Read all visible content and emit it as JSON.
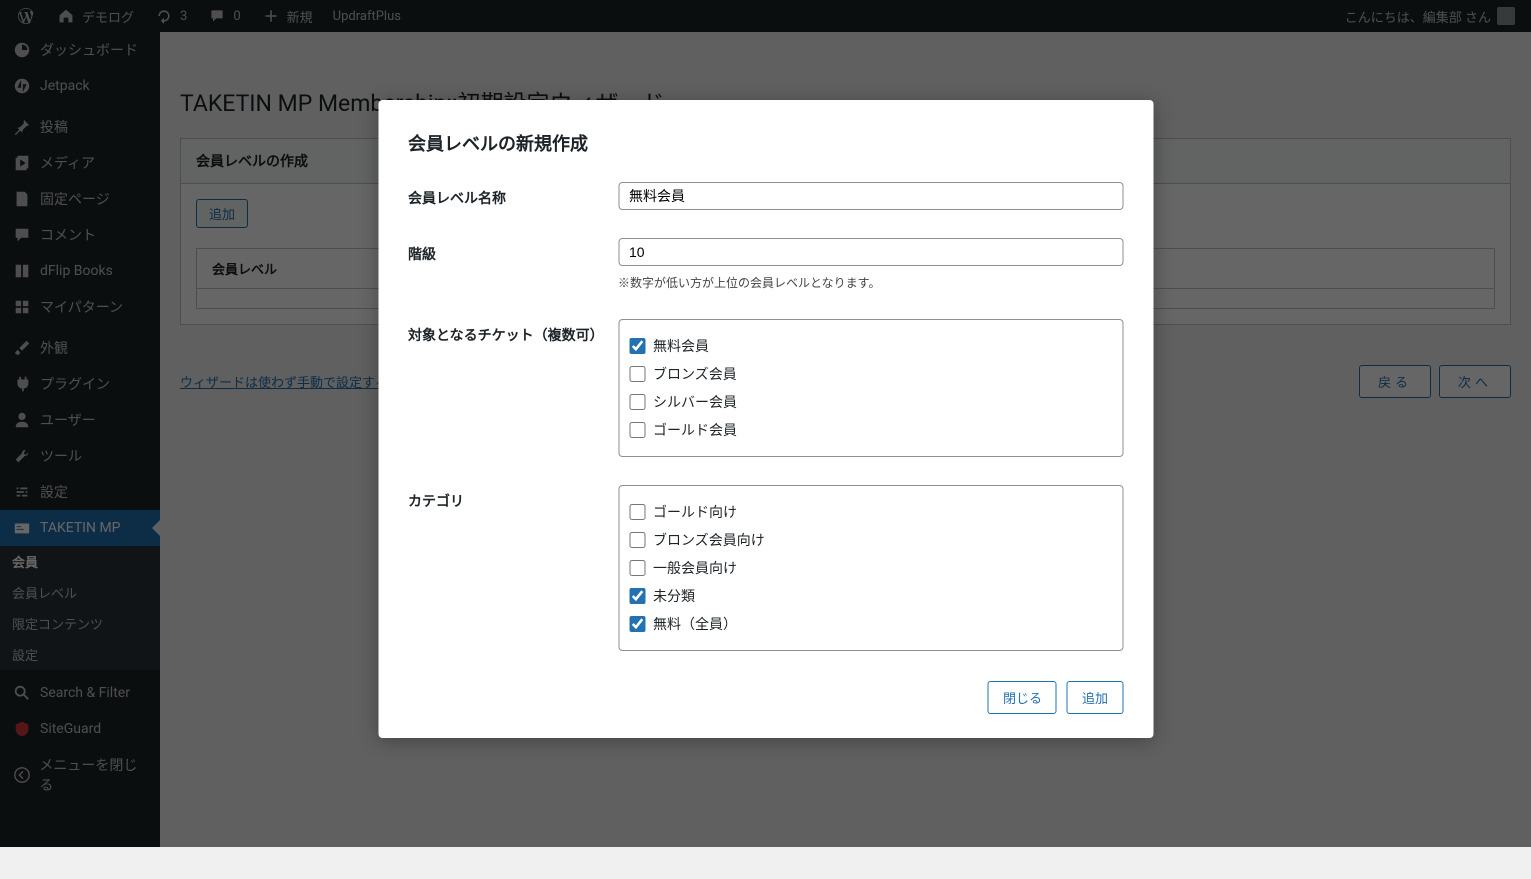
{
  "adminbar": {
    "site_name": "デモログ",
    "updates_count": "3",
    "comments_count": "0",
    "new_label": "新規",
    "updraft_label": "UpdraftPlus",
    "greeting": "こんにちは、編集部 さん"
  },
  "sidebar": {
    "items": [
      {
        "label": "ダッシュボード",
        "icon": "dashboard"
      },
      {
        "label": "Jetpack",
        "icon": "jetpack"
      },
      {
        "label": "投稿",
        "icon": "pin"
      },
      {
        "label": "メディア",
        "icon": "media"
      },
      {
        "label": "固定ページ",
        "icon": "page"
      },
      {
        "label": "コメント",
        "icon": "comment"
      },
      {
        "label": "dFlip Books",
        "icon": "book"
      },
      {
        "label": "マイパターン",
        "icon": "pattern"
      },
      {
        "label": "外観",
        "icon": "brush"
      },
      {
        "label": "プラグイン",
        "icon": "plugin"
      },
      {
        "label": "ユーザー",
        "icon": "user"
      },
      {
        "label": "ツール",
        "icon": "tool"
      },
      {
        "label": "設定",
        "icon": "settings"
      },
      {
        "label": "TAKETIN MP",
        "icon": "card"
      },
      {
        "label": "Search & Filter",
        "icon": "search"
      },
      {
        "label": "SiteGuard",
        "icon": "shield"
      },
      {
        "label": "メニューを閉じる",
        "icon": "collapse"
      }
    ],
    "submenu": [
      {
        "label": "会員",
        "active": true
      },
      {
        "label": "会員レベル",
        "active": false
      },
      {
        "label": "限定コンテンツ",
        "active": false
      },
      {
        "label": "設定",
        "active": false
      }
    ]
  },
  "page": {
    "title": "TAKETIN MP Membership::初期設定ウィザード",
    "panel_title": "会員レベルの作成",
    "add_button": "追加",
    "table_header": "会員レベル",
    "manual_link": "ウィザードは使わず手動で設定する",
    "back_button": "戻る",
    "next_button": "次へ"
  },
  "modal": {
    "title": "会員レベルの新規作成",
    "name_label": "会員レベル名称",
    "name_value": "無料会員",
    "rank_label": "階級",
    "rank_value": "10",
    "rank_help": "※数字が低い方が上位の会員レベルとなります。",
    "tickets_label": "対象となるチケット（複数可）",
    "tickets": [
      {
        "label": "無料会員",
        "checked": true
      },
      {
        "label": "ブロンズ会員",
        "checked": false
      },
      {
        "label": "シルバー会員",
        "checked": false
      },
      {
        "label": "ゴールド会員",
        "checked": false
      }
    ],
    "category_label": "カテゴリ",
    "categories": [
      {
        "label": "ゴールド向け",
        "checked": false
      },
      {
        "label": "ブロンズ会員向け",
        "checked": false
      },
      {
        "label": "一般会員向け",
        "checked": false
      },
      {
        "label": "未分類",
        "checked": true
      },
      {
        "label": "無料（全員）",
        "checked": true
      }
    ],
    "close_button": "閉じる",
    "add_button": "追加"
  }
}
